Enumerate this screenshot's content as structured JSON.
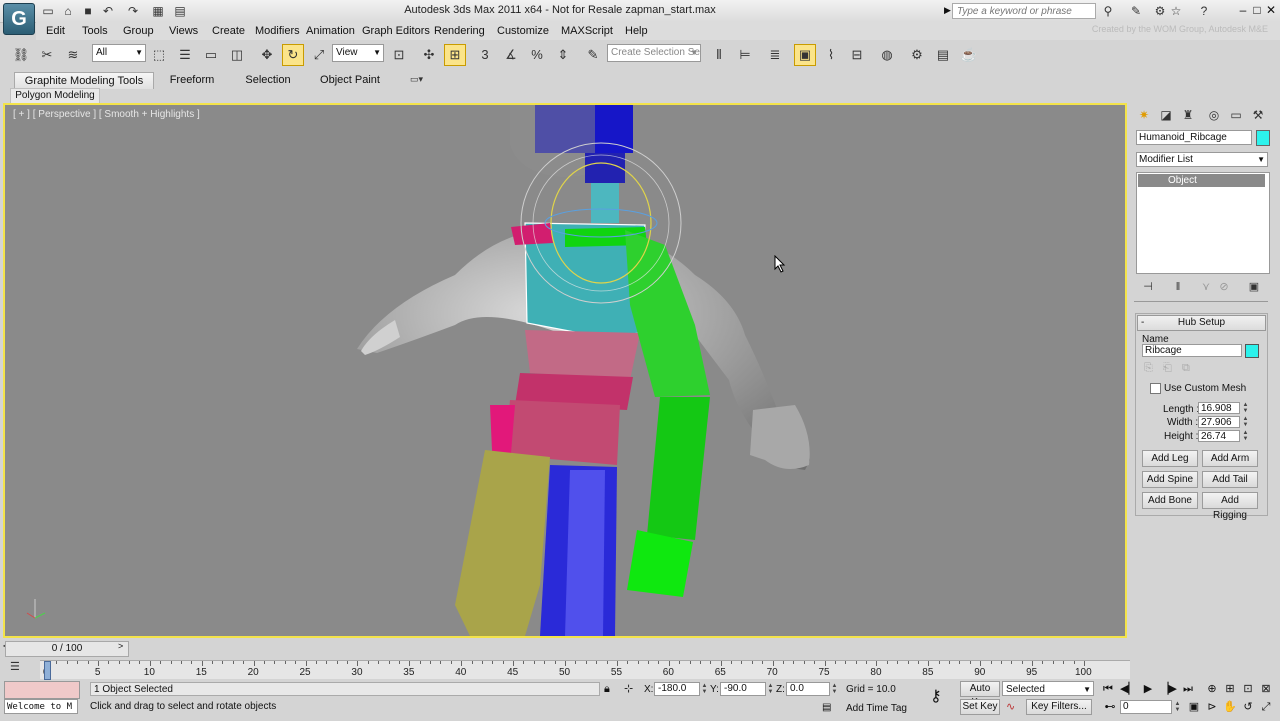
{
  "title_bar": {
    "title": "Autodesk 3ds Max  2011 x64   -  Not for Resale    zapman_start.max",
    "search_placeholder": "Type a keyword or phrase"
  },
  "menu": [
    "Edit",
    "Tools",
    "Group",
    "Views",
    "Create",
    "Modifiers",
    "Animation",
    "Graph Editors",
    "Rendering",
    "Customize",
    "MAXScript",
    "Help"
  ],
  "credit": "Created by the WOM Group, Autodesk M&E",
  "toolbar": {
    "selection_filter": "All",
    "ref_coord": "View",
    "named_selection_placeholder": "Create Selection Se"
  },
  "ribbon": {
    "tabs": [
      "Graphite Modeling Tools",
      "Freeform",
      "Selection",
      "Object Paint"
    ],
    "sub_tab": "Polygon Modeling"
  },
  "viewport": {
    "label": "[ + ] [ Perspective ] [ Smooth + Highlights ]"
  },
  "command_panel": {
    "object_name": "Humanoid_Ribcage",
    "object_color": "#2cf2ec",
    "modifier_list": "Modifier List",
    "stack_item": "Object",
    "rollout_title": "Hub Setup",
    "rollout_toggle": "-",
    "name_label": "Name",
    "name_value": "Ribcage",
    "use_custom_mesh": "Use Custom Mesh",
    "length_label": "Length :",
    "length": "16.908",
    "width_label": "Width :",
    "width": "27.906",
    "height_label": "Height :",
    "height": "26.74",
    "buttons": [
      "Add Leg",
      "Add Arm",
      "Add Spine",
      "Add Tail",
      "Add Bone",
      "Add Rigging"
    ]
  },
  "timeline": {
    "frame": "0 / 100",
    "ticks": [
      "0",
      "5",
      "10",
      "15",
      "20",
      "25",
      "30",
      "35",
      "40",
      "45",
      "50",
      "55",
      "60",
      "65",
      "70",
      "75",
      "80",
      "85",
      "90",
      "95",
      "100"
    ]
  },
  "status": {
    "listener": "Welcome to M",
    "selection": "1 Object Selected",
    "prompt": "Click and drag to select and rotate objects",
    "x": "-180.0",
    "y": "-90.0",
    "z": "0.0",
    "grid": "Grid = 10.0",
    "add_time_tag": "Add Time Tag",
    "auto_key": "Auto Key",
    "set_key": "Set Key",
    "selected": "Selected",
    "key_filters": "Key Filters...",
    "frame_field": "0"
  }
}
